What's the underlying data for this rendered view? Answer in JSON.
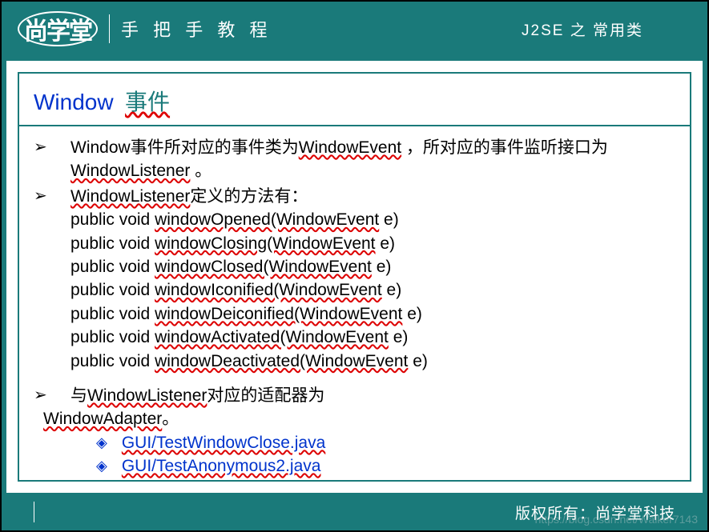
{
  "header": {
    "logo": "尚学堂",
    "tagline": "手 把 手 教 程",
    "topic": "J2SE 之 常用类"
  },
  "title": {
    "main": "Window",
    "sub": "事件"
  },
  "bullets": {
    "b1_pre": "Window",
    "b1_mid": "事件所对应的事件类为",
    "b1_u1": "WindowEvent",
    "b1_post1": " ，所对应的事件监听接口为",
    "b1_u2": "WindowListener",
    "b1_end": " 。",
    "b2_u": "WindowListener",
    "b2_post": "定义的方法有：",
    "b3_pre": "与",
    "b3_u": "WindowListener",
    "b3_post": "对应的适配器为",
    "adapter_u": "WindowAdapter",
    "adapter_end": "。"
  },
  "methods": [
    {
      "pre": "public void ",
      "u": "windowOpened(WindowEvent",
      "post": " e)"
    },
    {
      "pre": "public void ",
      "u": "windowClosing(WindowEvent",
      "post": " e)"
    },
    {
      "pre": "public void ",
      "u": "windowClosed(WindowEvent",
      "post": " e)"
    },
    {
      "pre": "public void ",
      "u": "windowIconified(WindowEvent",
      "post": " e)"
    },
    {
      "pre": "public void ",
      "u": "windowDeiconified(WindowEvent",
      "post": " e)"
    },
    {
      "pre": "public void ",
      "u": "windowActivated(WindowEvent",
      "post": " e)"
    },
    {
      "pre": "public void ",
      "u": "windowDeactivated(WindowEvent",
      "post": " e)"
    }
  ],
  "links": [
    "GUI/TestWindowClose.java",
    "GUI/TestAnonymous2.java"
  ],
  "footer": {
    "copyright": "版权所有：尚学堂科技"
  },
  "watermark": "https://blog.csdn.net/Walker7143"
}
